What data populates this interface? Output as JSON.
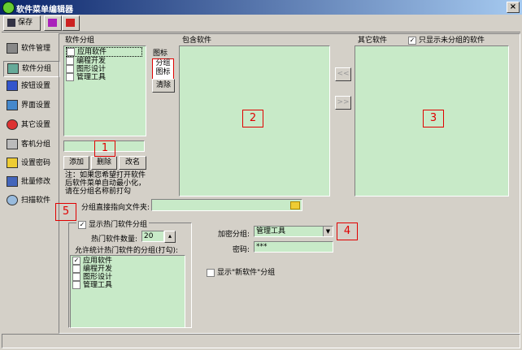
{
  "window": {
    "title": "软件菜单编辑器",
    "close": "×"
  },
  "toolbar": {
    "save_label": "保存"
  },
  "nav": [
    "软件管理",
    "软件分组",
    "按钮设置",
    "界面设置",
    "其它设置",
    "客机分组",
    "设置密码",
    "批量修改",
    "扫描软件"
  ],
  "group": {
    "header": "软件分组",
    "items": [
      "应用软件",
      "编程开发",
      "图形设计",
      "管理工具"
    ],
    "add": "添加",
    "delete": "删除",
    "rename": "改名",
    "note": [
      "注：如果您希望打开软件",
      "后软件菜单自动最小化，",
      "请在分组名称前打勾"
    ]
  },
  "icon": {
    "header": "图标",
    "preview": [
      "分组",
      "图标"
    ],
    "clear": "清除"
  },
  "included": {
    "header": "包含软件"
  },
  "other": {
    "header": "其它软件",
    "only_unassigned": "只显示未分组的软件"
  },
  "arrows": {
    "left": "<<",
    "right": ">>"
  },
  "folder": {
    "label": "分组直接指向文件夹:"
  },
  "hot": {
    "show_label": "显示热门软件分组",
    "count_label": "热门软件数量:",
    "count_value": "20",
    "allow_label": "允许统计热门软件的分组(打勾):",
    "items": [
      "应用软件",
      "编程开发",
      "图形设计",
      "管理工具"
    ]
  },
  "encrypt": {
    "label": "加密分组:",
    "value": "管理工具",
    "password_label": "密码:",
    "password_value": "***"
  },
  "new_soft": {
    "label": "显示\"新软件\"分组"
  },
  "markers": [
    "1",
    "2",
    "3",
    "4",
    "5"
  ],
  "colors": {
    "list_bg": "#c8eac8",
    "marker": "#e00000",
    "title_bar": "#0a246a"
  }
}
